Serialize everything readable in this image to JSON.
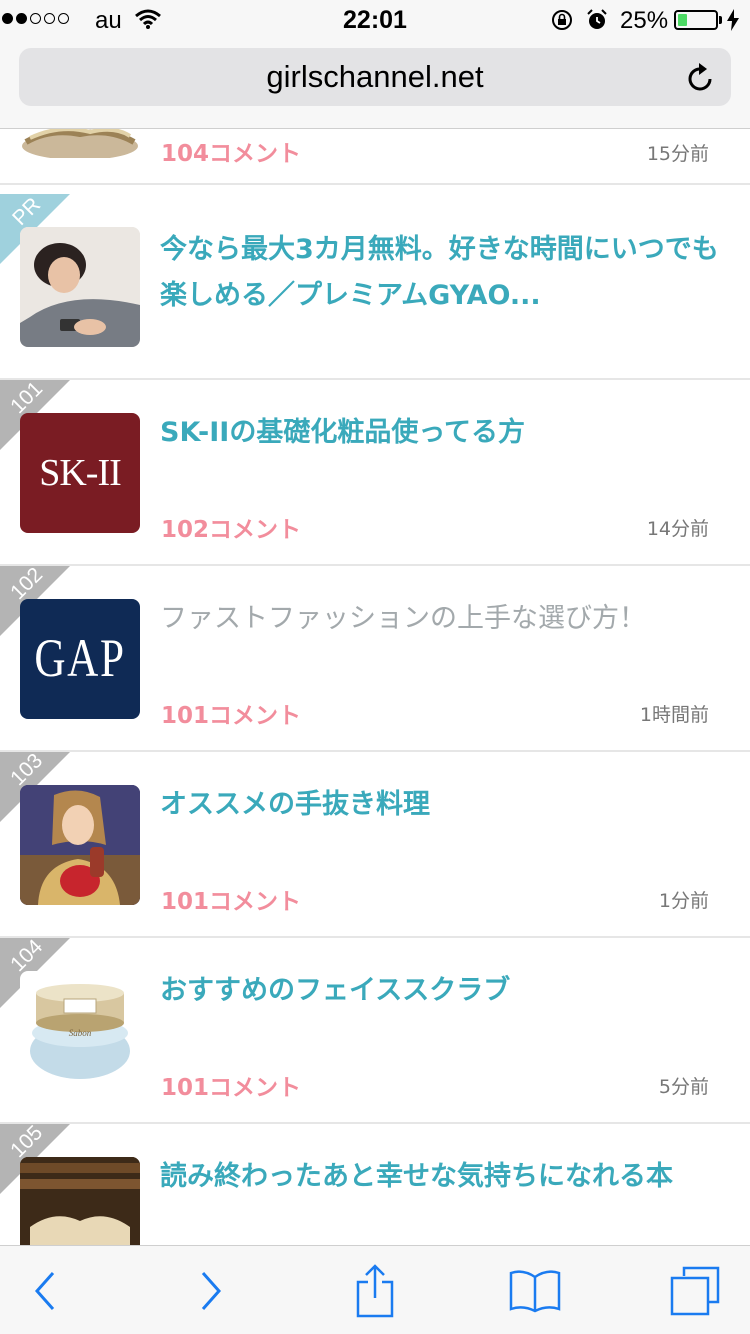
{
  "status_bar": {
    "carrier": "au",
    "time": "22:01",
    "battery_percent": "25%",
    "battery_level": 0.25,
    "signal_bars_filled": 2
  },
  "browser": {
    "url": "girlschannel.net",
    "icons": [
      "reload-icon",
      "back-icon",
      "forward-icon",
      "share-icon",
      "bookmarks-icon",
      "tabs-icon"
    ]
  },
  "colors": {
    "title_link": "#3aa9bb",
    "title_visited": "#a3a9ac",
    "comment_count": "#f28d9c",
    "rank_ribbon": "#b4b4b4",
    "pr_ribbon": "#9fd1dd"
  },
  "list": {
    "rows": [
      {
        "rank": "",
        "title": "",
        "comments": "104コメント",
        "time": "15分前"
      },
      {
        "rank": "PR",
        "title": "今なら最大3カ月無料。好きな時間にいつでも楽しめる／プレミアムGYAO...",
        "comments": "",
        "time": ""
      },
      {
        "rank": "101",
        "title": "SK-IIの基礎化粧品使ってる方",
        "comments": "102コメント",
        "time": "14分前",
        "thumb_text": "SK-II"
      },
      {
        "rank": "102",
        "title": "ファストファッションの上手な選び方！",
        "comments": "101コメント",
        "time": "1時間前",
        "thumb_text": "GAP"
      },
      {
        "rank": "103",
        "title": "オススメの手抜き料理",
        "comments": "101コメント",
        "time": "1分前"
      },
      {
        "rank": "104",
        "title": "おすすめのフェイススクラブ",
        "comments": "101コメント",
        "time": "5分前",
        "thumb_text": "Sabon"
      },
      {
        "rank": "105",
        "title": "読み終わったあと幸せな気持ちになれる本",
        "comments": "",
        "time": ""
      }
    ]
  }
}
